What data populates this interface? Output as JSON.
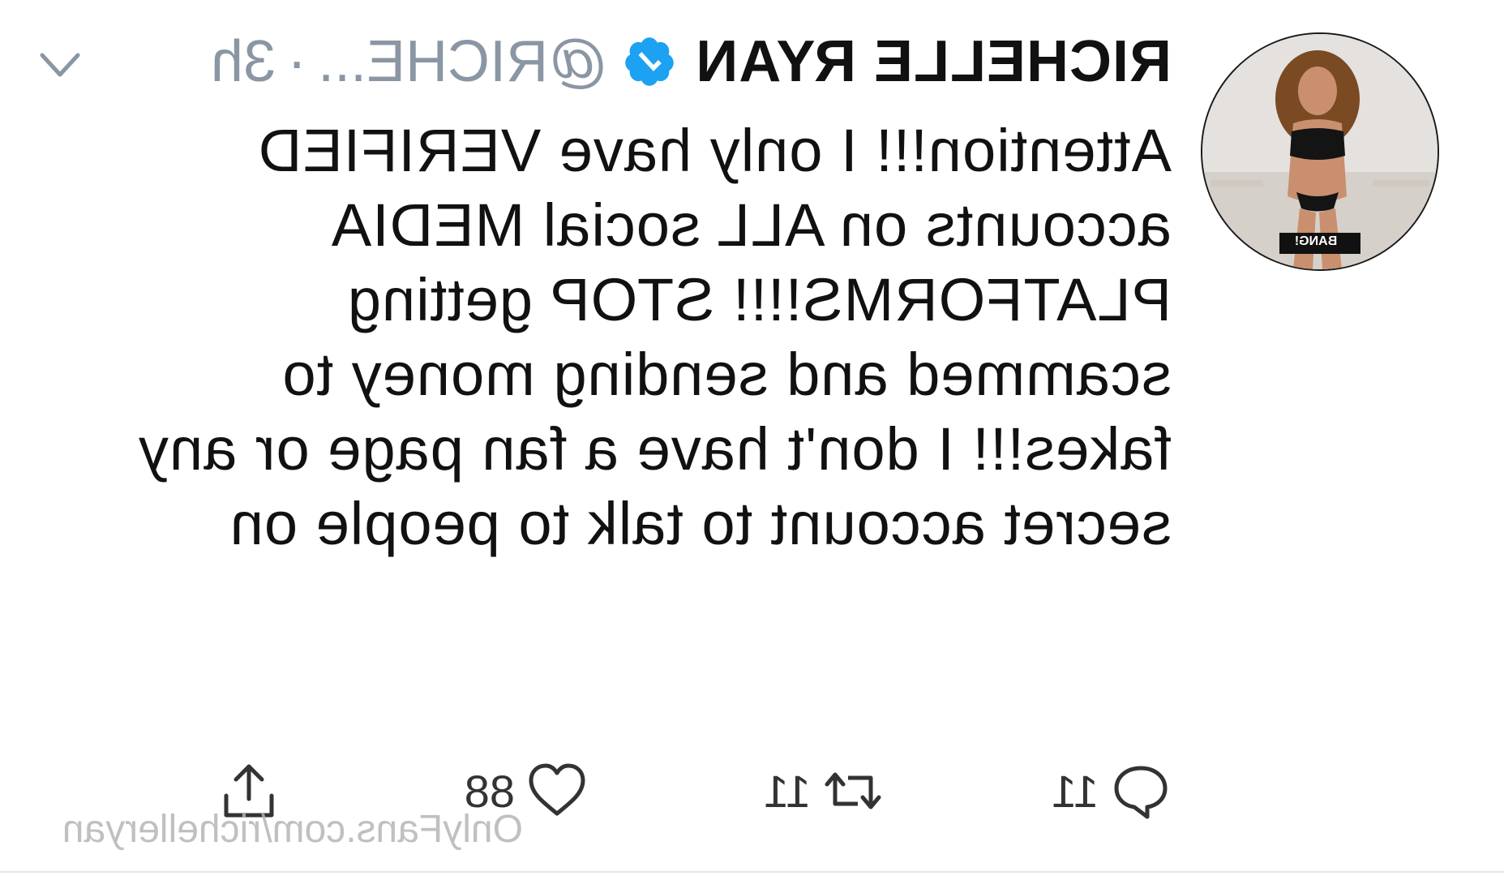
{
  "tweet": {
    "display_name": "RICHELLE RYAN",
    "handle": "@RICHE...",
    "separator": "·",
    "time": "3h",
    "text": "Attention!!! I only have VERIFIED accounts on ALL social MEDIA PLATFORMS!!!! STOP getting scammed and sending money to fakes!!! I don't have a fan page or any secret account to talk to people on",
    "avatar_badge": "BANG!"
  },
  "actions": {
    "reply_count": "11",
    "retweet_count": "11",
    "like_count": "88"
  },
  "watermark": "OnlyFans.com/richelleryan",
  "colors": {
    "verified_blue": "#1da1f2",
    "meta_gray": "#8a96a3",
    "text": "#111111",
    "watermark": "#b5b5b5"
  },
  "icons": {
    "verified": "verified-badge-icon",
    "menu": "chevron-down-icon",
    "reply": "reply-icon",
    "retweet": "retweet-icon",
    "like": "heart-icon",
    "share": "share-icon"
  }
}
